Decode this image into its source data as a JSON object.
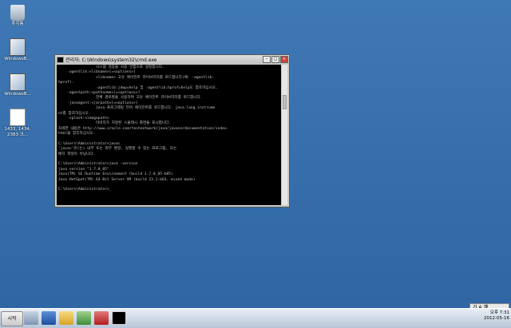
{
  "desktop": {
    "icons": [
      {
        "name": "recycle-bin",
        "label": "휴지통"
      },
      {
        "name": "windows-shortcut-1",
        "label": "WindowsB..."
      },
      {
        "name": "windows-shortcut-2",
        "label": "WindowsB..."
      },
      {
        "name": "text-file",
        "label": "1433, 1434, 2383 크..."
      }
    ]
  },
  "cmd_window": {
    "title": "관리자: C:\\Windows\\system32\\cmd.exe",
    "lines": [
      "                 시스템 검증을 사용 안함으로 설정합니다.",
      "    -agentlib:<libname>[=<options>]",
      "                 <libname> 고유 에이전트 라이브러리를 로드합니다(예: -agentlib:",
      "hprof).",
      "                 -agentlib:jdwp=help 및 -agentlib:hprof=help도 참조하십시오.",
      "    -agentpath:<pathname>[=<options>]",
      "                 전체 경로명을 사용하여 고유 에이전트 라이브러리를 로드합니다.",
      "    -javaagent:<jarpath>[=<options>]",
      "                 Java 프로그래밍 언어 에이전트를 로드합니다. java.lang.instrume",
      "nt를 참조하십시오.",
      "    -splash:<imagepath>",
      "                 이미지가 지정된 스플래시 화면을 표시합니다.",
      "자세한 내용은 http://www.oracle.com/technetwork/java/javase/documentation/index.",
      "html을 참조하십시오.",
      "",
      "C:\\Users\\Administrator>javac",
      "'javac'은(는) 내부 또는 외부 명령, 실행할 수 있는 프로그램, 또는",
      "배치 파일이 아닙니다.",
      "",
      "C:\\Users\\Administrator>java -version",
      "java version \"1.7.0_05\"",
      "Java(TM) SE Runtime Environment (build 1.7.0_05-b05)",
      "Java HotSpot(TM) 64-Bit Server VM (build 23.1-b03, mixed mode)",
      "",
      "C:\\Users\\Administrator>_"
    ]
  },
  "taskbar": {
    "start_label": "시작",
    "language": "가 A 漢",
    "time": "오후 7:31",
    "date": "2012-05-16"
  }
}
